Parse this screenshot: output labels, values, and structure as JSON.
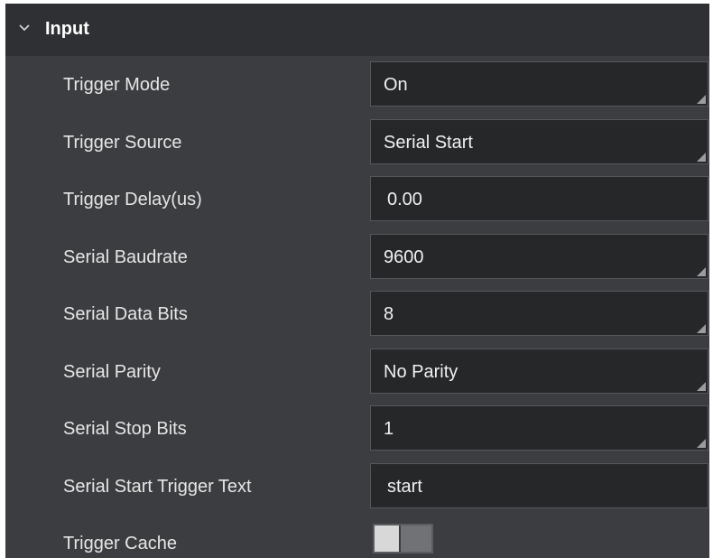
{
  "section": {
    "title": "Input",
    "icon": "chevron-down-icon"
  },
  "rows": [
    {
      "label": "Trigger Mode",
      "value": "On",
      "type": "select"
    },
    {
      "label": "Trigger Source",
      "value": "Serial Start",
      "type": "select"
    },
    {
      "label": "Trigger Delay(us)",
      "value": "0.00",
      "type": "input"
    },
    {
      "label": "Serial Baudrate",
      "value": "9600",
      "type": "select"
    },
    {
      "label": "Serial Data Bits",
      "value": "8",
      "type": "select"
    },
    {
      "label": "Serial Parity",
      "value": "No Parity",
      "type": "select"
    },
    {
      "label": "Serial Stop Bits",
      "value": "1",
      "type": "select"
    },
    {
      "label": "Serial Start Trigger Text",
      "value": "start",
      "type": "input"
    },
    {
      "label": "Trigger Cache",
      "value": false,
      "type": "toggle"
    }
  ],
  "colors": {
    "panel_bg": "#3c3d40",
    "header_bg": "#2f3033",
    "field_bg": "#262729",
    "field_border": "#55575c",
    "text": "#e6e6e6"
  }
}
